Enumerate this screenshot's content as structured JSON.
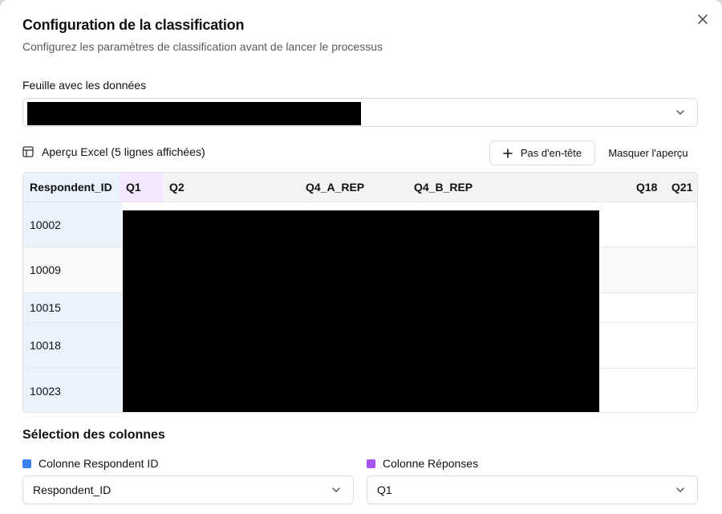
{
  "dialog": {
    "title": "Configuration de la classification",
    "subtitle": "Configurez les paramètres de classification avant de lancer le processus"
  },
  "sheet": {
    "label": "Feuille avec les données",
    "value": ""
  },
  "preview": {
    "title": "Aperçu Excel (5 lignes affichées)",
    "no_header_button": "Pas d'en-tête",
    "hide_button": "Masquer l'aperçu",
    "columns": [
      "Respondent_ID",
      "Q1",
      "Q2",
      "Q4_A_REP",
      "Q4_B_REP",
      "Q18",
      "Q21"
    ],
    "rows": [
      "10002",
      "10009",
      "10015",
      "10018",
      "10023"
    ]
  },
  "columns_section": {
    "title": "Sélection des colonnes",
    "respondent_label": "Colonne Respondent ID",
    "respondent_value": "Respondent_ID",
    "responses_label": "Colonne Réponses",
    "responses_value": "Q1"
  },
  "colors": {
    "respondent_marker": "#3b82f6",
    "responses_marker": "#a855f7",
    "id_column_bg": "#eaf3fd",
    "q1_column_bg": "#f3e8fd"
  }
}
